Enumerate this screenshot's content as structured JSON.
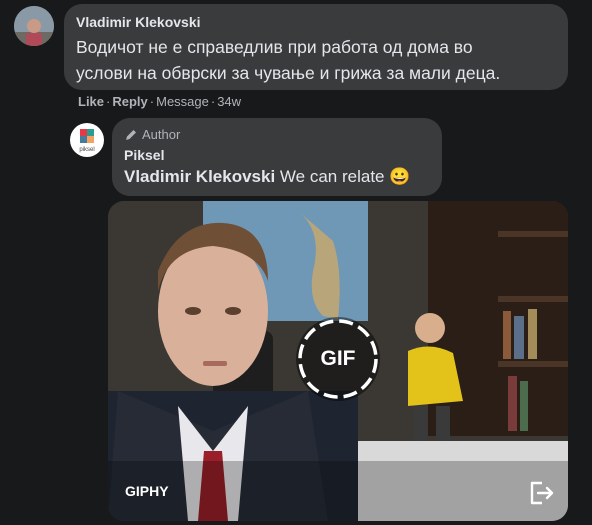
{
  "comment": {
    "author": "Vladimir Klekovski",
    "text_line1": "Водичот не е справедлив при работа од дома во",
    "text_line2": "услови на обврски за чување и грижа за мали деца.",
    "actions": {
      "like": "Like",
      "reply": "Reply",
      "message": "Message",
      "age": "34w"
    }
  },
  "reply": {
    "badge": "Author",
    "page_name": "Piksel",
    "mention": "Vladimir Klekovski",
    "text": "We can relate",
    "emoji": "😀",
    "avatar_logo_text": "piksel"
  },
  "gif": {
    "badge_label": "GIF",
    "provider": "GIPHY"
  },
  "icons": [
    "pencil-icon",
    "open-external-icon",
    "gif-loop-icon"
  ],
  "colors": {
    "background": "#18191a",
    "bubble": "#3a3b3c",
    "text": "#e4e6eb",
    "muted": "#b0b3b8"
  }
}
